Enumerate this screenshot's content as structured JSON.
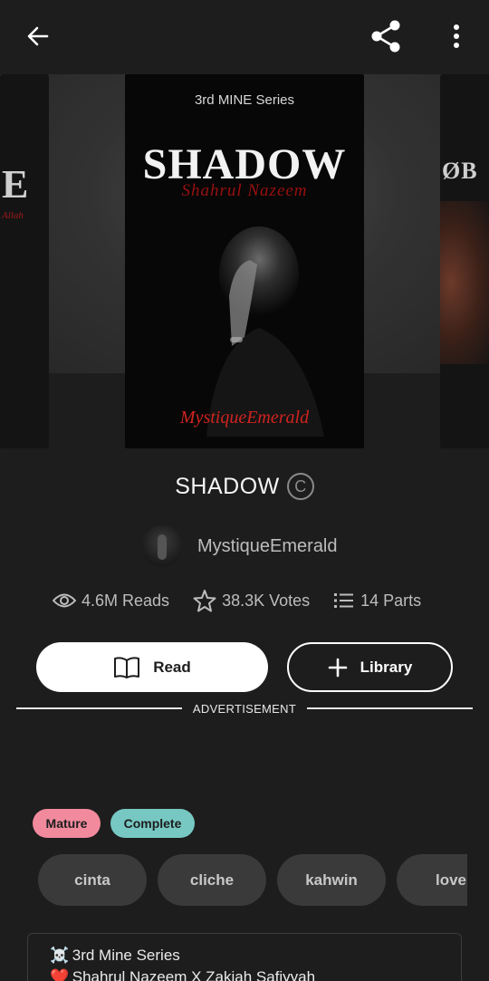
{
  "header": {
    "back_icon": "arrow-left-icon",
    "share_icon": "share-icon",
    "more_icon": "more-vertical-icon"
  },
  "carousel": {
    "left_cover_text": "E",
    "left_cover_sub": "Allah",
    "right_cover_text": "ØB",
    "main_cover": {
      "series": "3rd MINE Series",
      "title": "SHADOW",
      "subtitle": "Shahrul Nazeem",
      "pen_name": "MystiqueEmerald"
    }
  },
  "story": {
    "title": "SHADOW",
    "copyright_glyph": "C",
    "author": "MystiqueEmerald"
  },
  "stats": {
    "reads": "4.6M Reads",
    "votes": "38.3K Votes",
    "parts": "14 Parts"
  },
  "actions": {
    "read_label": "Read",
    "library_label": "Library"
  },
  "ad": {
    "label": "ADVERTISEMENT"
  },
  "badges": {
    "mature": "Mature",
    "complete": "Complete",
    "mature_color": "#f08a9c",
    "complete_color": "#77c8c2"
  },
  "tags": [
    "cinta",
    "cliche",
    "kahwin",
    "love"
  ],
  "description": {
    "line1_icon": "☠️",
    "line1": "3rd Mine Series",
    "line2_icon": "❤️",
    "line2": "Shahrul Nazeem X Zakiah Safiyyah"
  }
}
